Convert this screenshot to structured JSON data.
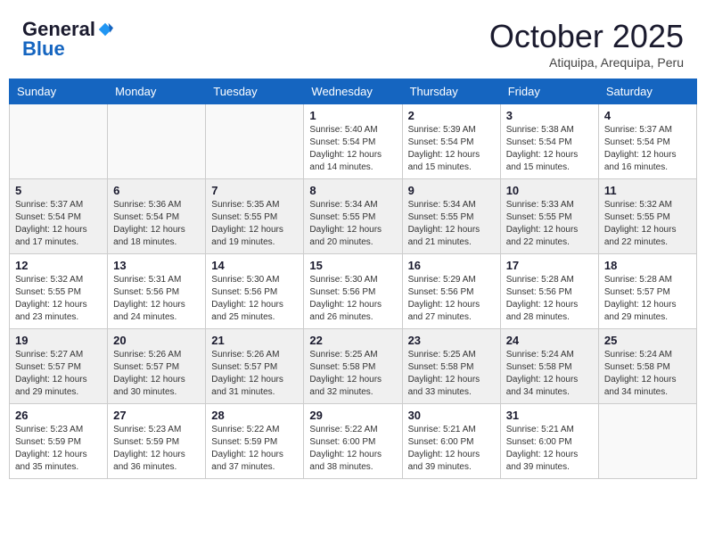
{
  "header": {
    "logo_general": "General",
    "logo_blue": "Blue",
    "month": "October 2025",
    "location": "Atiquipa, Arequipa, Peru"
  },
  "days_of_week": [
    "Sunday",
    "Monday",
    "Tuesday",
    "Wednesday",
    "Thursday",
    "Friday",
    "Saturday"
  ],
  "weeks": [
    {
      "shaded": false,
      "days": [
        {
          "number": "",
          "info": ""
        },
        {
          "number": "",
          "info": ""
        },
        {
          "number": "",
          "info": ""
        },
        {
          "number": "1",
          "info": "Sunrise: 5:40 AM\nSunset: 5:54 PM\nDaylight: 12 hours\nand 14 minutes."
        },
        {
          "number": "2",
          "info": "Sunrise: 5:39 AM\nSunset: 5:54 PM\nDaylight: 12 hours\nand 15 minutes."
        },
        {
          "number": "3",
          "info": "Sunrise: 5:38 AM\nSunset: 5:54 PM\nDaylight: 12 hours\nand 15 minutes."
        },
        {
          "number": "4",
          "info": "Sunrise: 5:37 AM\nSunset: 5:54 PM\nDaylight: 12 hours\nand 16 minutes."
        }
      ]
    },
    {
      "shaded": true,
      "days": [
        {
          "number": "5",
          "info": "Sunrise: 5:37 AM\nSunset: 5:54 PM\nDaylight: 12 hours\nand 17 minutes."
        },
        {
          "number": "6",
          "info": "Sunrise: 5:36 AM\nSunset: 5:54 PM\nDaylight: 12 hours\nand 18 minutes."
        },
        {
          "number": "7",
          "info": "Sunrise: 5:35 AM\nSunset: 5:55 PM\nDaylight: 12 hours\nand 19 minutes."
        },
        {
          "number": "8",
          "info": "Sunrise: 5:34 AM\nSunset: 5:55 PM\nDaylight: 12 hours\nand 20 minutes."
        },
        {
          "number": "9",
          "info": "Sunrise: 5:34 AM\nSunset: 5:55 PM\nDaylight: 12 hours\nand 21 minutes."
        },
        {
          "number": "10",
          "info": "Sunrise: 5:33 AM\nSunset: 5:55 PM\nDaylight: 12 hours\nand 22 minutes."
        },
        {
          "number": "11",
          "info": "Sunrise: 5:32 AM\nSunset: 5:55 PM\nDaylight: 12 hours\nand 22 minutes."
        }
      ]
    },
    {
      "shaded": false,
      "days": [
        {
          "number": "12",
          "info": "Sunrise: 5:32 AM\nSunset: 5:55 PM\nDaylight: 12 hours\nand 23 minutes."
        },
        {
          "number": "13",
          "info": "Sunrise: 5:31 AM\nSunset: 5:56 PM\nDaylight: 12 hours\nand 24 minutes."
        },
        {
          "number": "14",
          "info": "Sunrise: 5:30 AM\nSunset: 5:56 PM\nDaylight: 12 hours\nand 25 minutes."
        },
        {
          "number": "15",
          "info": "Sunrise: 5:30 AM\nSunset: 5:56 PM\nDaylight: 12 hours\nand 26 minutes."
        },
        {
          "number": "16",
          "info": "Sunrise: 5:29 AM\nSunset: 5:56 PM\nDaylight: 12 hours\nand 27 minutes."
        },
        {
          "number": "17",
          "info": "Sunrise: 5:28 AM\nSunset: 5:56 PM\nDaylight: 12 hours\nand 28 minutes."
        },
        {
          "number": "18",
          "info": "Sunrise: 5:28 AM\nSunset: 5:57 PM\nDaylight: 12 hours\nand 29 minutes."
        }
      ]
    },
    {
      "shaded": true,
      "days": [
        {
          "number": "19",
          "info": "Sunrise: 5:27 AM\nSunset: 5:57 PM\nDaylight: 12 hours\nand 29 minutes."
        },
        {
          "number": "20",
          "info": "Sunrise: 5:26 AM\nSunset: 5:57 PM\nDaylight: 12 hours\nand 30 minutes."
        },
        {
          "number": "21",
          "info": "Sunrise: 5:26 AM\nSunset: 5:57 PM\nDaylight: 12 hours\nand 31 minutes."
        },
        {
          "number": "22",
          "info": "Sunrise: 5:25 AM\nSunset: 5:58 PM\nDaylight: 12 hours\nand 32 minutes."
        },
        {
          "number": "23",
          "info": "Sunrise: 5:25 AM\nSunset: 5:58 PM\nDaylight: 12 hours\nand 33 minutes."
        },
        {
          "number": "24",
          "info": "Sunrise: 5:24 AM\nSunset: 5:58 PM\nDaylight: 12 hours\nand 34 minutes."
        },
        {
          "number": "25",
          "info": "Sunrise: 5:24 AM\nSunset: 5:58 PM\nDaylight: 12 hours\nand 34 minutes."
        }
      ]
    },
    {
      "shaded": false,
      "days": [
        {
          "number": "26",
          "info": "Sunrise: 5:23 AM\nSunset: 5:59 PM\nDaylight: 12 hours\nand 35 minutes."
        },
        {
          "number": "27",
          "info": "Sunrise: 5:23 AM\nSunset: 5:59 PM\nDaylight: 12 hours\nand 36 minutes."
        },
        {
          "number": "28",
          "info": "Sunrise: 5:22 AM\nSunset: 5:59 PM\nDaylight: 12 hours\nand 37 minutes."
        },
        {
          "number": "29",
          "info": "Sunrise: 5:22 AM\nSunset: 6:00 PM\nDaylight: 12 hours\nand 38 minutes."
        },
        {
          "number": "30",
          "info": "Sunrise: 5:21 AM\nSunset: 6:00 PM\nDaylight: 12 hours\nand 39 minutes."
        },
        {
          "number": "31",
          "info": "Sunrise: 5:21 AM\nSunset: 6:00 PM\nDaylight: 12 hours\nand 39 minutes."
        },
        {
          "number": "",
          "info": ""
        }
      ]
    }
  ]
}
